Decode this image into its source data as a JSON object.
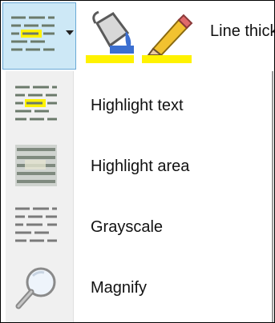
{
  "toolbar": {
    "buttons": [
      {
        "icon": "text-highlight-icon",
        "has_dropdown": true
      },
      {
        "icon": "paint-bucket-icon",
        "color": "#fff200"
      },
      {
        "icon": "pencil-icon",
        "color": "#fff200"
      }
    ],
    "line_thickness_label": "Line thick"
  },
  "menu": {
    "items": [
      {
        "label": "Highlight text",
        "icon": "highlight-text-icon"
      },
      {
        "label": "Highlight area",
        "icon": "highlight-area-icon"
      },
      {
        "label": "Grayscale",
        "icon": "grayscale-icon"
      },
      {
        "label": "Magnify",
        "icon": "magnify-icon"
      }
    ]
  },
  "colors": {
    "highlight": "#fff200",
    "selected_bg": "#cde8f6",
    "selected_border": "#6aa9d6"
  }
}
